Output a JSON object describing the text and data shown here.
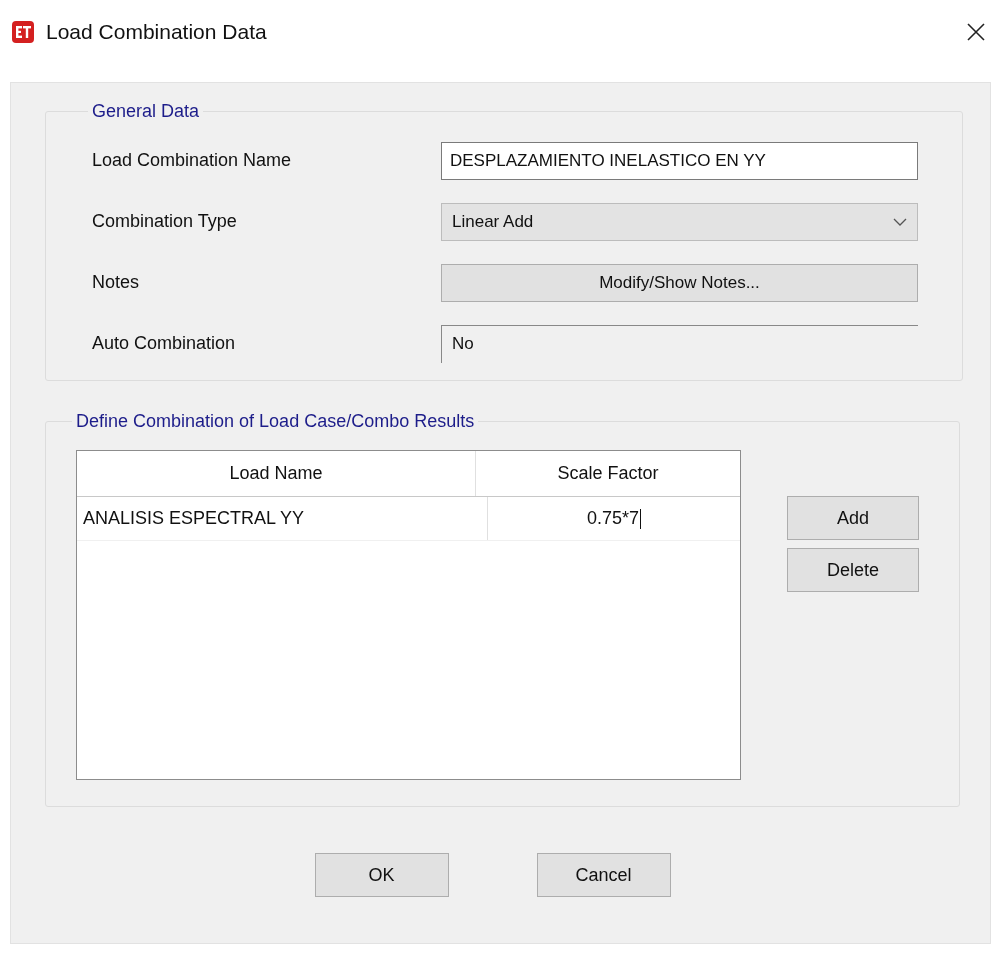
{
  "window": {
    "title": "Load Combination Data"
  },
  "general_data": {
    "title": "General Data",
    "fields": [
      {
        "kind": "text",
        "label": "Load Combination Name",
        "value": "DESPLAZAMIENTO INELASTICO EN YY"
      },
      {
        "kind": "dropdown",
        "label": "Combination Type",
        "value": "Linear Add"
      },
      {
        "kind": "button",
        "label": "Notes",
        "value": "Modify/Show Notes..."
      },
      {
        "kind": "readonly",
        "label": "Auto Combination",
        "value": "No"
      }
    ]
  },
  "combination": {
    "title": "Define Combination of Load Case/Combo Results",
    "table": {
      "columns": [
        "Load Name",
        "Scale Factor"
      ],
      "rows": [
        {
          "cells": [
            "ANALISIS ESPECTRAL YY",
            "0.75*7"
          ],
          "editing": true
        }
      ]
    },
    "buttons": [
      "Add",
      "Delete"
    ]
  },
  "buttons": [
    "OK",
    "Cancel"
  ]
}
